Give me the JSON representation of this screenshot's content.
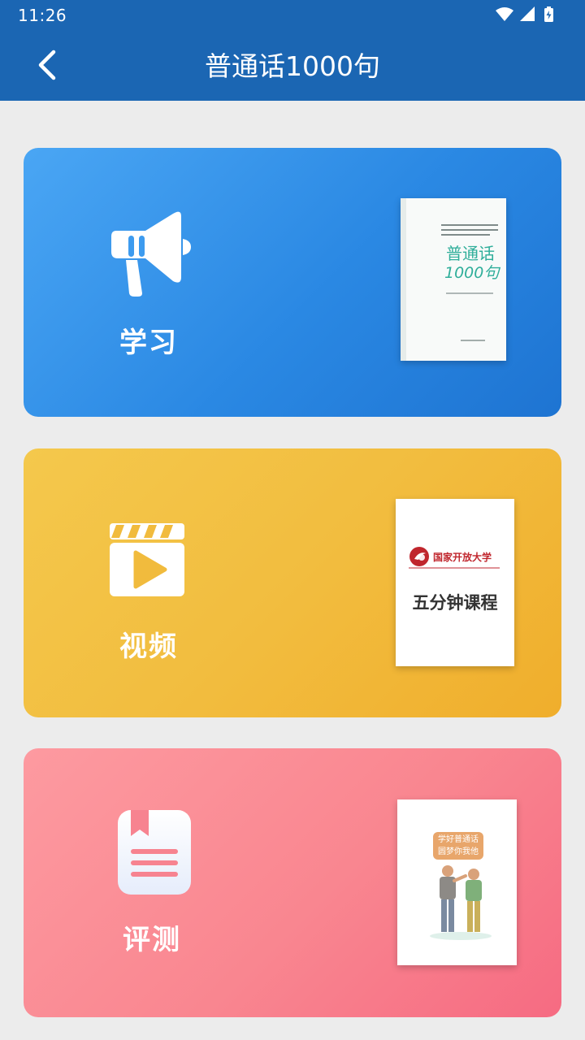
{
  "status_bar": {
    "time": "11:26"
  },
  "app_bar": {
    "title": "普通话1000句"
  },
  "cards": {
    "study": {
      "label": "学习",
      "cover": {
        "title_line1": "普通话",
        "title_line2": "1000句"
      }
    },
    "video": {
      "label": "视频",
      "cover": {
        "org": "国家开放大学",
        "course": "五分钟课程"
      }
    },
    "test": {
      "label": "评测",
      "cover": {
        "bubble_line1": "学好普通话",
        "bubble_line2": "圆梦你我他"
      }
    }
  },
  "colors": {
    "primary": "#1b66b3",
    "study_card": "#2a88e3",
    "video_card": "#f2bd3f",
    "test_card": "#f98690",
    "background": "#ececec"
  },
  "icons": {
    "back": "back-arrow-icon",
    "wifi": "wifi-icon",
    "signal": "signal-icon",
    "battery": "battery-charging-icon",
    "study": "megaphone-icon",
    "video": "clapperboard-play-icon",
    "test": "bookmark-document-icon"
  }
}
